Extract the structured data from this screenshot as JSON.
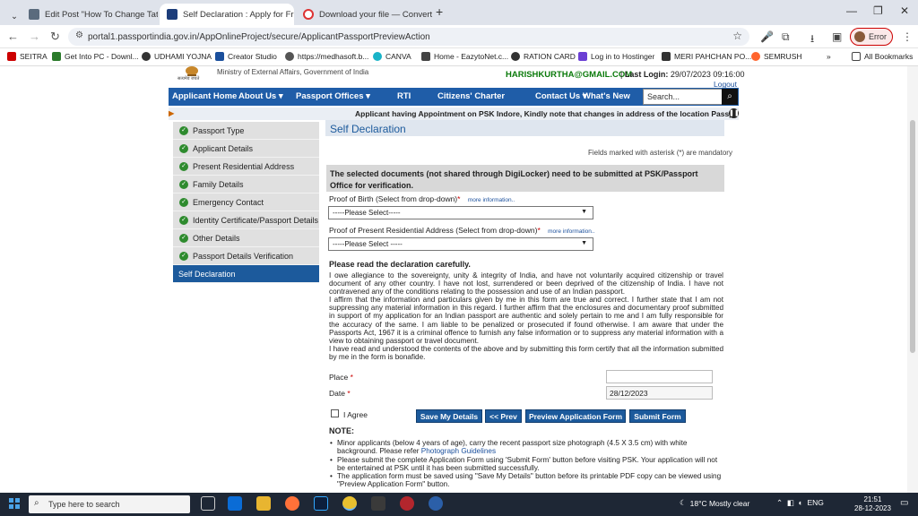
{
  "browser": {
    "tabs": [
      {
        "title": "Edit Post \"How To Change Tatk",
        "color": "#5a6b7d"
      },
      {
        "title": "Self Declaration : Apply for Fre",
        "color": "#1c3d7a"
      },
      {
        "title": "Download your file — Convertic",
        "color": "#d33"
      }
    ],
    "new_tab": "+",
    "url": "portal1.passportindia.gov.in/AppOnlineProject/secure/ApplicantPassportPreviewAction",
    "error_label": "Error"
  },
  "bookmarks": {
    "items": [
      {
        "label": "SEITRA",
        "color": "#c00"
      },
      {
        "label": "Get Into PC - Downl...",
        "color": "#2a7a2a"
      },
      {
        "label": "UDHAMI YOJNA",
        "color": "#333"
      },
      {
        "label": "Creator Studio",
        "color": "#1a4f9c"
      },
      {
        "label": "https://medhasoft.b...",
        "color": "#555"
      },
      {
        "label": "CANVA",
        "color": "#19b3c8"
      },
      {
        "label": "Home - EazytoNet.c...",
        "color": "#444"
      },
      {
        "label": "RATION CARD",
        "color": "#333"
      },
      {
        "label": "Log in to Hostinger",
        "color": "#6b3fd4"
      },
      {
        "label": "MERI PAHCHAN PO...",
        "color": "#333"
      },
      {
        "label": "SEMRUSH",
        "color": "#ff642d"
      }
    ],
    "more": "»",
    "all_bookmarks": "All Bookmarks"
  },
  "header": {
    "emblem_caption": "सत्यमेव जयते",
    "ministry": "Ministry of External Affairs, Government of India",
    "email": "HARISHKURTHA@GMAIL.COM",
    "separator": "|",
    "last_login_label": "Last Login:",
    "last_login_value": "29/07/2023 09:16:00",
    "logout": "Logout"
  },
  "nav": {
    "items": [
      "Applicant Home",
      "About Us ▾",
      "Passport Offices ▾",
      "RTI",
      "Citizens' Charter",
      "Contact Us ▾",
      "What's New"
    ],
    "search_placeholder": "Search..."
  },
  "ticker": "Applicant having Appointment on PSK Indore, Kindly note that changes in address of the location Passport Sev",
  "sidebar": {
    "items": [
      {
        "label": "Passport Type",
        "done": true
      },
      {
        "label": "Applicant Details",
        "done": true
      },
      {
        "label": "Present Residential Address",
        "done": true
      },
      {
        "label": "Family Details",
        "done": true
      },
      {
        "label": "Emergency Contact",
        "done": true
      },
      {
        "label": "Identity Certificate/Passport Details",
        "done": true
      },
      {
        "label": "Other Details",
        "done": true
      },
      {
        "label": "Passport Details Verification",
        "done": true
      },
      {
        "label": "Self Declaration",
        "done": false
      }
    ]
  },
  "main": {
    "title": "Self Declaration",
    "mandatory_note": "Fields marked with asterisk (*) are mandatory",
    "doc_notice": "The selected documents (not shared through DigiLocker) need to be submitted at PSK/Passport Office for verification.",
    "proof_birth_label": "Proof of Birth (Select from drop-down)",
    "proof_address_label": "Proof of Present Residential Address (Select from drop-down)",
    "asterisk": "*",
    "more_info": "more information..",
    "select_birth": "-----Please Select-----",
    "select_address": "-----Please Select -----",
    "decl_heading": "Please read the declaration carefully.",
    "decl_paragraphs": [
      "I owe allegiance to the sovereignty, unity & integrity of India, and have not voluntarily acquired citizenship or travel document of any other country. I have not lost, surrendered or been deprived of the citizenship of India. I have not contravened any of the conditions relating to the possession and use of an Indian passport.",
      "I affirm that the information and particulars given by me in this form are true and correct. I further state that I am not suppressing any material information in this regard. I further affirm that the enclosures and documentary proof submitted in support of my application for an Indian passport are authentic and solely pertain to me and I am fully responsible for the accuracy of the same. I am liable to be penalized or prosecuted if found otherwise. I am aware that under the Passports Act, 1967 it is a criminal offence to furnish any false information or to suppress any material information with a view to obtaining passport or travel document.",
      "I have read and understood the contents of the above and by submitting this form certify that all the information submitted by me in the form is bonafide."
    ],
    "place_label": "Place",
    "place_value": "",
    "date_label": "Date",
    "date_value": "28/12/2023",
    "agree_label": "I Agree",
    "buttons": {
      "save": "Save My Details",
      "prev": "<< Prev",
      "preview": "Preview Application Form",
      "submit": "Submit Form"
    },
    "note_heading": "NOTE:",
    "note1_text": "Minor applicants (below 4 years of age), carry the recent passport size photograph (4.5 X 3.5 cm) with white background. Please refer",
    "note1_link": "Photograph Guidelines",
    "note2": "Please submit the complete Application Form using 'Submit Form' button before visiting PSK. Your application will not be entertained at PSK until it has been submitted successfully.",
    "note3": "The application form must be saved using \"Save My Details\" button before its printable PDF copy can be viewed using \"Preview Application Form\" button."
  },
  "taskbar": {
    "search_placeholder": "Type here to search",
    "weather": "18°C  Mostly clear",
    "lang": "ENG",
    "time": "21:51",
    "date": "28-12-2023"
  }
}
